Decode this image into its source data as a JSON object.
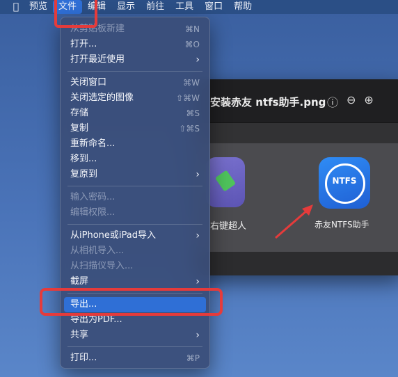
{
  "menubar": {
    "items": [
      "预览",
      "文件",
      "编辑",
      "显示",
      "前往",
      "工具",
      "窗口",
      "帮助"
    ]
  },
  "menu": {
    "items": [
      {
        "label": "从剪贴板新建",
        "shortcut": "⌘N",
        "disabled": true
      },
      {
        "label": "打开...",
        "shortcut": "⌘O"
      },
      {
        "label": "打开最近使用",
        "submenu": true
      },
      {
        "separator": true
      },
      {
        "label": "关闭窗口",
        "shortcut": "⌘W"
      },
      {
        "label": "关闭选定的图像",
        "shortcut": "⇧⌘W"
      },
      {
        "label": "存储",
        "shortcut": "⌘S"
      },
      {
        "label": "复制",
        "shortcut": "⇧⌘S"
      },
      {
        "label": "重新命名..."
      },
      {
        "label": "移到..."
      },
      {
        "label": "复原到",
        "submenu": true
      },
      {
        "separator": true
      },
      {
        "label": "输入密码...",
        "disabled": true
      },
      {
        "label": "编辑权限...",
        "disabled": true
      },
      {
        "separator": true
      },
      {
        "label": "从iPhone或iPad导入",
        "submenu": true
      },
      {
        "label": "从相机导入...",
        "disabled": true
      },
      {
        "label": "从扫描仪导入...",
        "disabled": true
      },
      {
        "label": "截屏",
        "submenu": true
      },
      {
        "separator": true
      },
      {
        "label": "导出...",
        "selected": true
      },
      {
        "label": "导出为PDF..."
      },
      {
        "label": "共享",
        "submenu": true
      },
      {
        "separator": true
      },
      {
        "label": "打印...",
        "shortcut": "⌘P"
      }
    ]
  },
  "window": {
    "title": "安装赤友 ntfs助手.png",
    "tools": [
      "ⓘ",
      "⊖",
      "⊕"
    ],
    "apps": [
      {
        "label": "右键超人"
      },
      {
        "label": "赤友NTFS助手",
        "icon_text": "NTFS"
      }
    ]
  },
  "colors": {
    "highlight": "#e53b3b",
    "selection": "#2f6fd6"
  }
}
